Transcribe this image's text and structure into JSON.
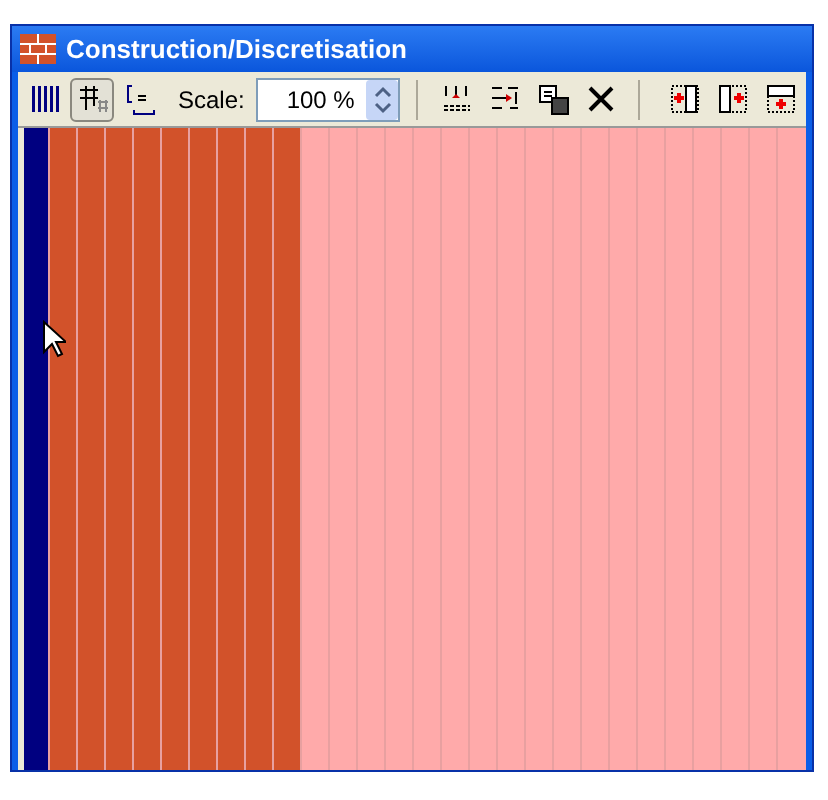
{
  "window": {
    "title": "Construction/Discretisation"
  },
  "toolbar": {
    "left_buttons": [
      {
        "kind": "bars",
        "pressed": false
      },
      {
        "kind": "grid",
        "pressed": true
      },
      {
        "kind": "bracket",
        "pressed": false
      }
    ],
    "scale_label": "Scale:",
    "scale_value": "100 %",
    "mid_buttons": [
      {
        "kind": "split",
        "pressed": false
      },
      {
        "kind": "insert",
        "pressed": false
      },
      {
        "kind": "copy",
        "pressed": false
      },
      {
        "kind": "delete",
        "pressed": false
      }
    ],
    "right_buttons": [
      {
        "kind": "add-left",
        "pressed": false
      },
      {
        "kind": "add-right",
        "pressed": false
      },
      {
        "kind": "add-row",
        "pressed": false
      }
    ]
  },
  "strip": {
    "segments": [
      {
        "color": "#000080"
      },
      {
        "color": "#d2522a"
      },
      {
        "color": "#d2522a"
      },
      {
        "color": "#d2522a"
      },
      {
        "color": "#d2522a"
      },
      {
        "color": "#d2522a"
      },
      {
        "color": "#d2522a"
      },
      {
        "color": "#d2522a"
      },
      {
        "color": "#d2522a"
      },
      {
        "color": "#d2522a"
      },
      {
        "color": "#ffaaaa"
      },
      {
        "color": "#ffaaaa"
      },
      {
        "color": "#ffaaaa"
      },
      {
        "color": "#ffaaaa"
      },
      {
        "color": "#ffaaaa"
      },
      {
        "color": "#ffaaaa"
      },
      {
        "color": "#ffaaaa"
      },
      {
        "color": "#ffaaaa"
      },
      {
        "color": "#ffaaaa"
      },
      {
        "color": "#ffaaaa"
      },
      {
        "color": "#ffaaaa"
      },
      {
        "color": "#ffaaaa"
      },
      {
        "color": "#ffaaaa"
      },
      {
        "color": "#ffaaaa"
      },
      {
        "color": "#ffaaaa"
      },
      {
        "color": "#ffaaaa"
      },
      {
        "color": "#ffaaaa"
      },
      {
        "color": "#ffaaaa"
      }
    ]
  }
}
